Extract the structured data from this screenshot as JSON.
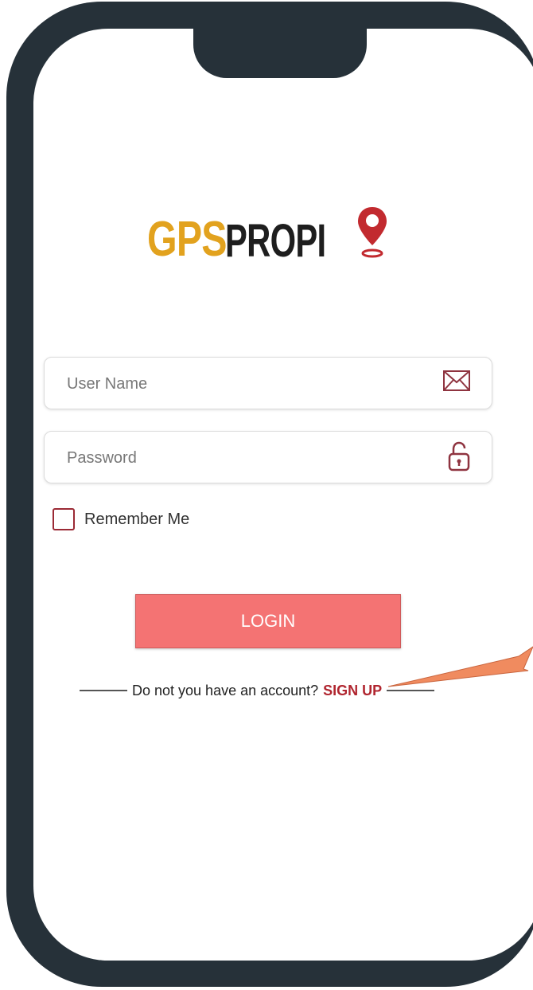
{
  "logo": {
    "part1": "GPS",
    "part2": "PROPI"
  },
  "form": {
    "username_placeholder": "User Name",
    "password_placeholder": "Password",
    "remember_label": "Remember Me",
    "login_label": "LOGIN"
  },
  "footer": {
    "question": "Do not you have an account?",
    "signup_label": "SIGN UP"
  },
  "icons": {
    "username": "envelope-icon",
    "password": "padlock-icon",
    "logo_pin": "location-pin-icon"
  },
  "colors": {
    "frame": "#263139",
    "logo_gold": "#e2a21e",
    "accent_red": "#b0252f",
    "login_button": "#f47373",
    "annotation_arrow": "#f08b5f"
  }
}
